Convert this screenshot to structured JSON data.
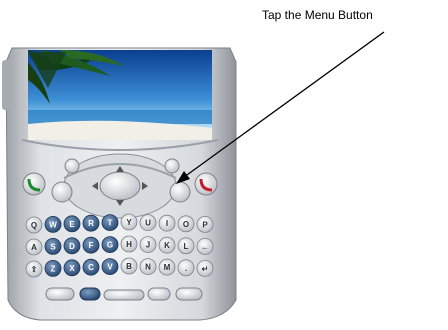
{
  "callout": {
    "text": "Tap the Menu Button"
  },
  "device": {
    "icon": "palm-treo-smartphone-icon"
  },
  "keyboard": {
    "row1": [
      "Q",
      "W",
      "E",
      "R",
      "T",
      "Y",
      "U",
      "I",
      "O",
      "P"
    ],
    "row2": [
      "A",
      "S",
      "D",
      "F",
      "G",
      "H",
      "J",
      "K",
      "L",
      "←"
    ],
    "row3": [
      "⇧",
      "Z",
      "X",
      "C",
      "V",
      "B",
      "N",
      "M",
      ".",
      "↵"
    ]
  },
  "colors": {
    "body": "#c9cdd2",
    "keyLight": "#e9ecef",
    "keyDark": "#2f5380",
    "screenSea": "#1a6fb8"
  }
}
